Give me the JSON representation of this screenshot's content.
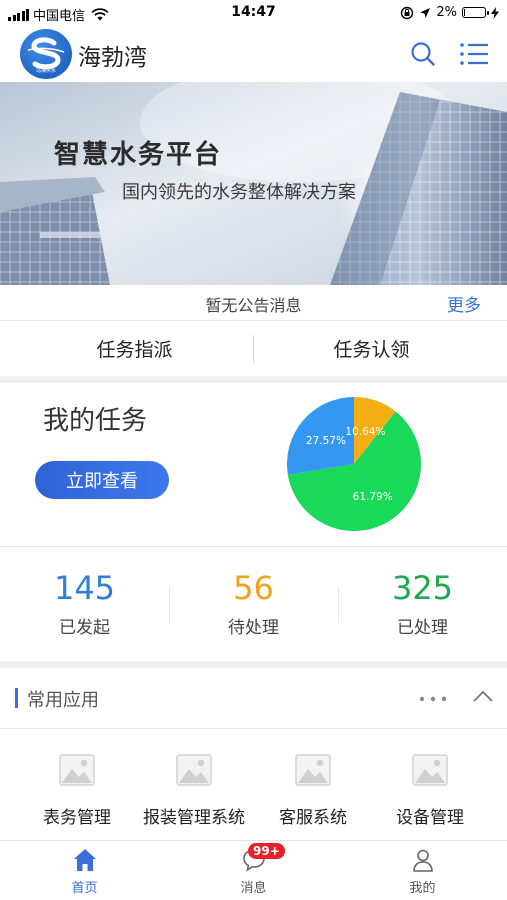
{
  "status_bar": {
    "carrier": "中国电信",
    "time": "14:47",
    "battery": "2%",
    "battery_level": 0.02
  },
  "header": {
    "app_name": "海勃湾",
    "logo_text": "乌海供水"
  },
  "banner": {
    "title": "智慧水务平台",
    "subtitle": "国内领先的水务整体解决方案"
  },
  "notice": {
    "text": "暂无公告消息",
    "more_label": "更多"
  },
  "task_tabs": [
    {
      "label": "任务指派"
    },
    {
      "label": "任务认领"
    }
  ],
  "my_tasks": {
    "title": "我的任务",
    "view_button": "立即查看"
  },
  "chart_data": {
    "type": "pie",
    "slices": [
      {
        "label": "10.64%",
        "value": 10.64,
        "color": "#f5ad14"
      },
      {
        "label": "61.79%",
        "value": 61.79,
        "color": "#19d85a"
      },
      {
        "label": "27.57%",
        "value": 27.57,
        "color": "#3598f0"
      }
    ]
  },
  "stats": [
    {
      "value": "145",
      "label": "已发起",
      "color": "#2f7fd6"
    },
    {
      "value": "56",
      "label": "待处理",
      "color": "#f0a21b"
    },
    {
      "value": "325",
      "label": "已处理",
      "color": "#1ea94e"
    }
  ],
  "common_apps": {
    "title": "常用应用",
    "items": [
      {
        "label": "表务管理",
        "icon": "image-placeholder-icon"
      },
      {
        "label": "报装管理系统",
        "icon": "image-placeholder-icon"
      },
      {
        "label": "客服系统",
        "icon": "image-placeholder-icon"
      },
      {
        "label": "设备管理",
        "icon": "image-placeholder-icon"
      }
    ]
  },
  "tabbar": {
    "items": [
      {
        "label": "首页",
        "icon": "home-icon"
      },
      {
        "label": "消息",
        "icon": "message-icon"
      },
      {
        "label": "我的",
        "icon": "user-icon"
      }
    ],
    "message_badge": "99+",
    "active_color": "#3a6fd9"
  }
}
